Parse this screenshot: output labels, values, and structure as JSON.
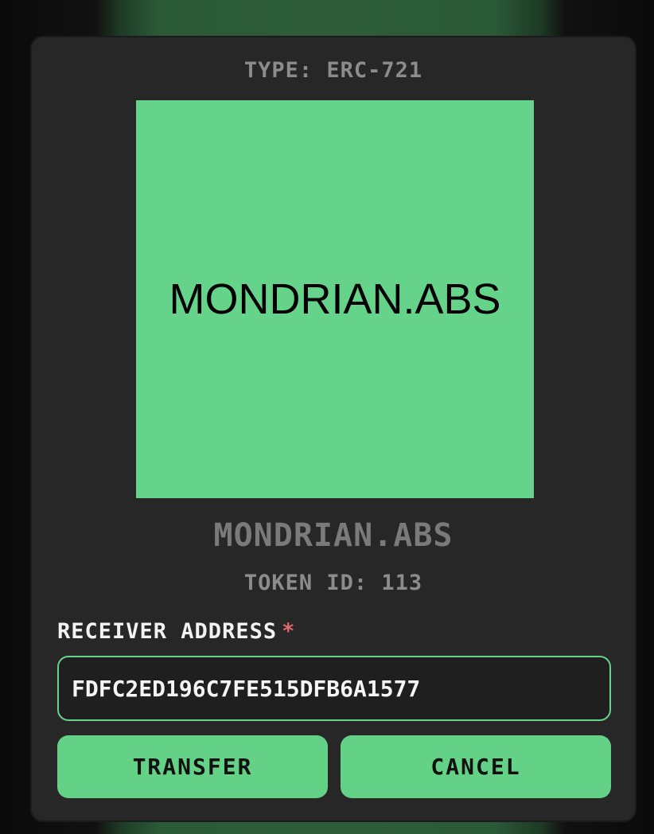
{
  "modal": {
    "type_label": "TYPE: ERC-721",
    "preview_text": "MONDRIAN.ABS",
    "nft_name": "MONDRIAN.ABS",
    "token_id": "TOKEN ID: 113",
    "receiver_label": "RECEIVER ADDRESS",
    "required_marker": "*",
    "receiver_value": "FDFC2ED196C7FE515DFB6A1577",
    "transfer_label": "TRANSFER",
    "cancel_label": "CANCEL"
  },
  "colors": {
    "accent": "#66d38a",
    "modal_bg": "#272727",
    "required": "#e06a6a"
  }
}
